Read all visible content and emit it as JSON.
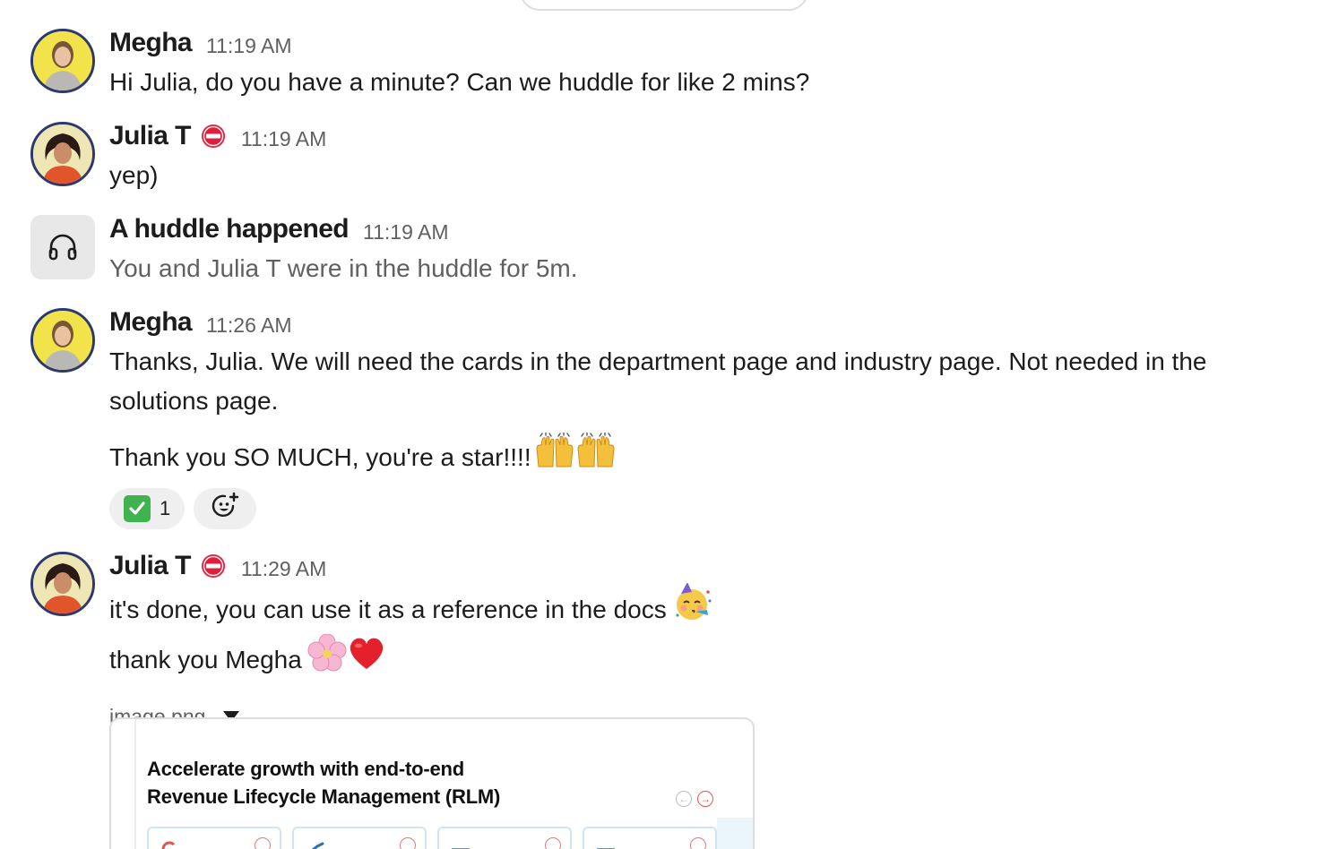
{
  "messages": [
    {
      "sender": "Megha",
      "time": "11:19 AM",
      "text": "Hi Julia, do you have a minute? Can we huddle for like 2 mins?"
    },
    {
      "sender": "Julia T",
      "status_icon": "no-entry-icon",
      "time": "11:19 AM",
      "text": "yep)"
    },
    {
      "sender": "A huddle happened",
      "icon": "headphones-icon",
      "time": "11:19 AM",
      "text": "You and Julia T were in the huddle for 5m."
    },
    {
      "sender": "Megha",
      "time": "11:26 AM",
      "text_line1": "Thanks, Julia. We will need the cards in the department page and industry page. Not needed in the",
      "text_line2": "solutions page.",
      "text_para2": "Thank you SO MUCH, you're a star!!!!",
      "emoji": [
        "raising-hands-icon",
        "raising-hands-icon"
      ],
      "reactions": [
        {
          "icon": "white-check-mark-icon",
          "count": "1"
        },
        {
          "icon": "add-reaction-icon"
        }
      ]
    },
    {
      "sender": "Julia T",
      "status_icon": "no-entry-icon",
      "time": "11:29 AM",
      "text_line1": "it's done, you can use it as a reference in the docs",
      "text_line2": "thank you Megha",
      "emoji_line1": "partying-face-icon",
      "emoji_line2": [
        "cherry-blossom-icon",
        "red-heart-icon"
      ],
      "attachment": {
        "filename": "image.png",
        "preview_title_line1": "Accelerate growth with end-to-end",
        "preview_title_line2": "Revenue Lifecycle Management (RLM)"
      }
    }
  ],
  "colors": {
    "text": "#1d1c1d",
    "muted": "#616061",
    "reaction_bg": "#efefef",
    "check_green": "#3fb34f",
    "status_red": "#e01e3c"
  }
}
